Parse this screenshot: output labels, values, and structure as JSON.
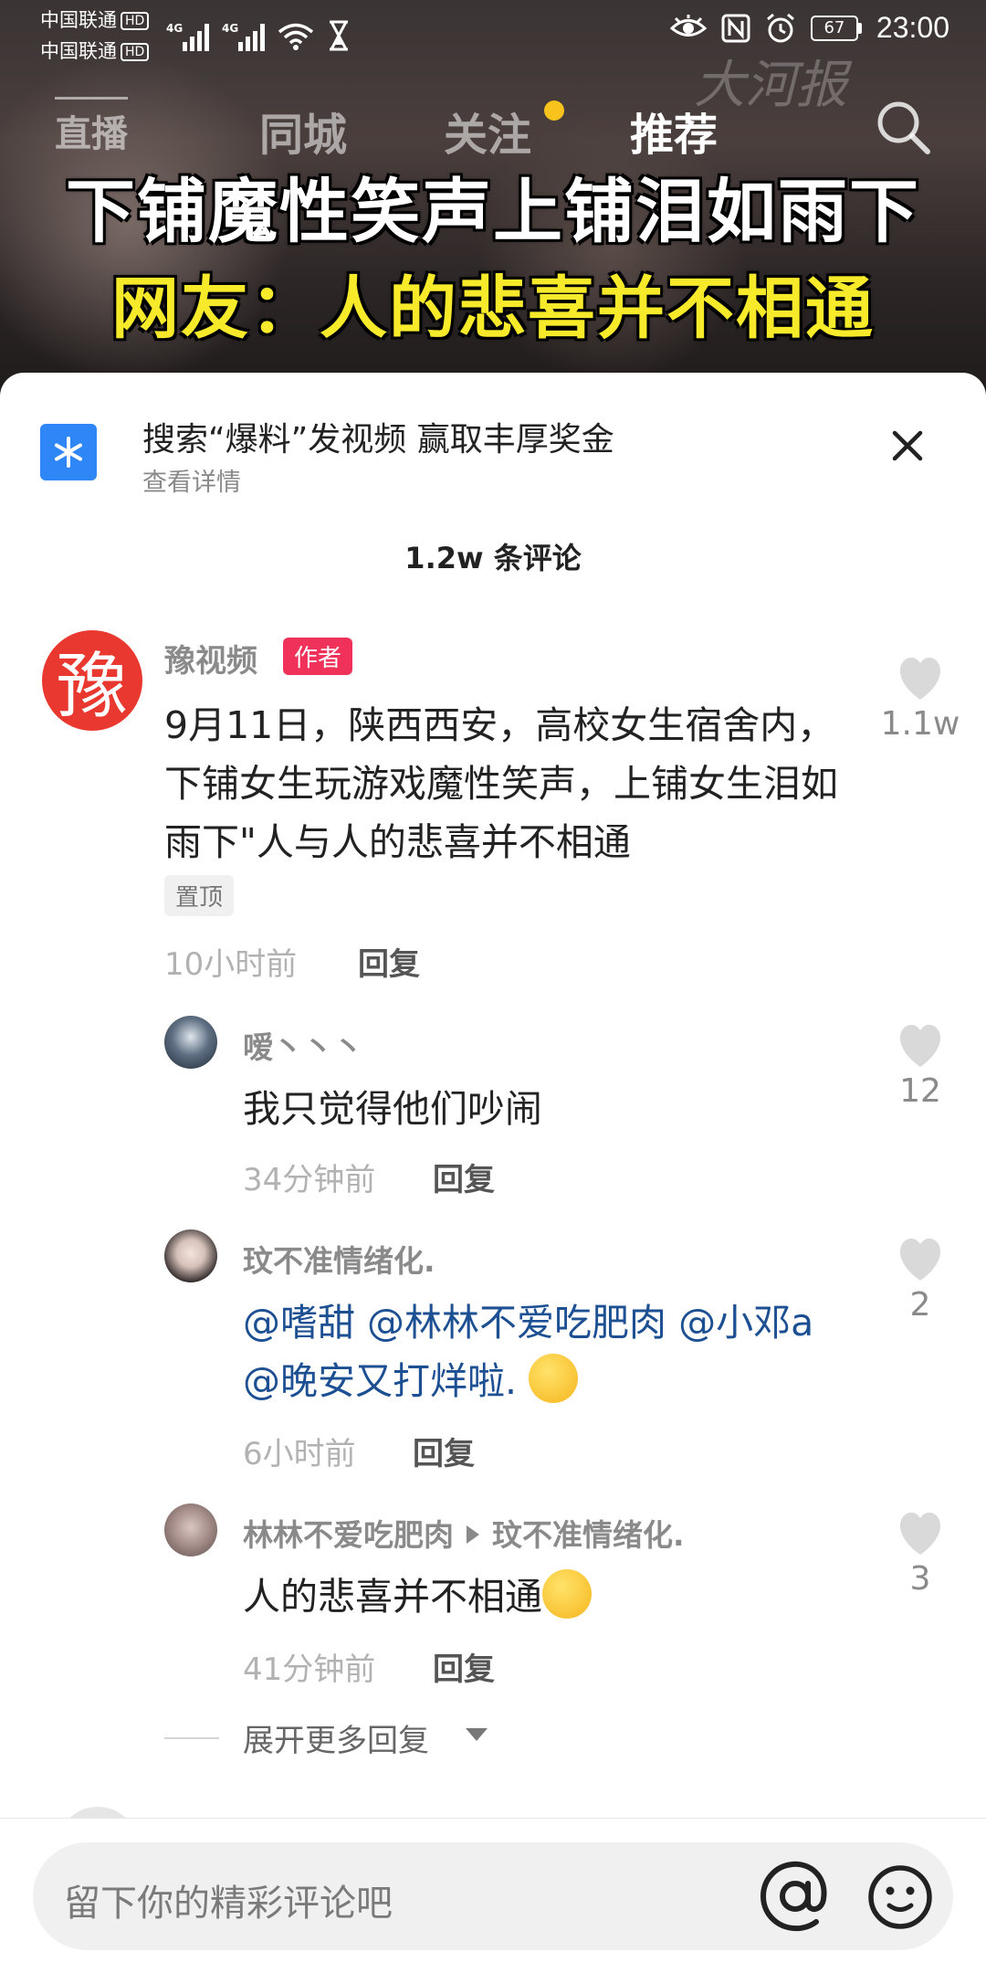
{
  "status_bar": {
    "carrier_1": "中国联通",
    "carrier_2": "中国联通",
    "hd_badge": "HD",
    "network_1": "4G",
    "network_2": "4G",
    "battery": "67",
    "time": "23:00"
  },
  "video": {
    "watermark": "大河报",
    "caption_line_1": "下铺魔性笑声上铺泪如雨下",
    "caption_line_2": "网友：人的悲喜并不相通"
  },
  "top_nav": {
    "tabs": [
      {
        "label": "直播"
      },
      {
        "label": "同城"
      },
      {
        "label": "关注"
      },
      {
        "label": "推荐"
      }
    ],
    "active_tab": "推荐"
  },
  "promo": {
    "title": "搜索“爆料”发视频 赢取丰厚奖金",
    "subtitle": "查看详情"
  },
  "comments_header": {
    "count_label": "1.2w 条评论"
  },
  "main_comment": {
    "avatar_char": "豫",
    "author": "豫视频",
    "badge": "作者",
    "text": "9月11日，陕西西安，高校女生宿舍内，下铺女生玩游戏魔性笑声，上铺女生泪如雨下\"人与人的悲喜并不相通",
    "pinned": "置顶",
    "time": "10小时前",
    "reply": "回复",
    "likes": "1.1w"
  },
  "replies": [
    {
      "author": "嗳丶丶丶",
      "text": "我只觉得他们吵闹",
      "time": "34分钟前",
      "reply": "回复",
      "likes": "12"
    },
    {
      "author": "玟不准情绪化.",
      "mention_line_1": "@嗜甜 @林林不爱吃肥肉 @小邓a",
      "mention_line_2": "@晚安又打烊啦.",
      "time": "6小时前",
      "reply": "回复",
      "likes": "2"
    },
    {
      "author": "林林不爱吃肥肉",
      "reply_to": "玟不准情绪化.",
      "text": "人的悲喜并不相通",
      "time": "41分钟前",
      "reply": "回复",
      "likes": "3"
    }
  ],
  "expand": {
    "label": "展开更多回复"
  },
  "input_bar": {
    "placeholder": "留下你的精彩评论吧"
  },
  "colors": {
    "author_badge": "#f0325a",
    "mention": "#1d4f93",
    "promo_icon": "#2f86f6",
    "follow_dot": "#f7c31c",
    "caption_yellow": "#f6ea2a"
  }
}
